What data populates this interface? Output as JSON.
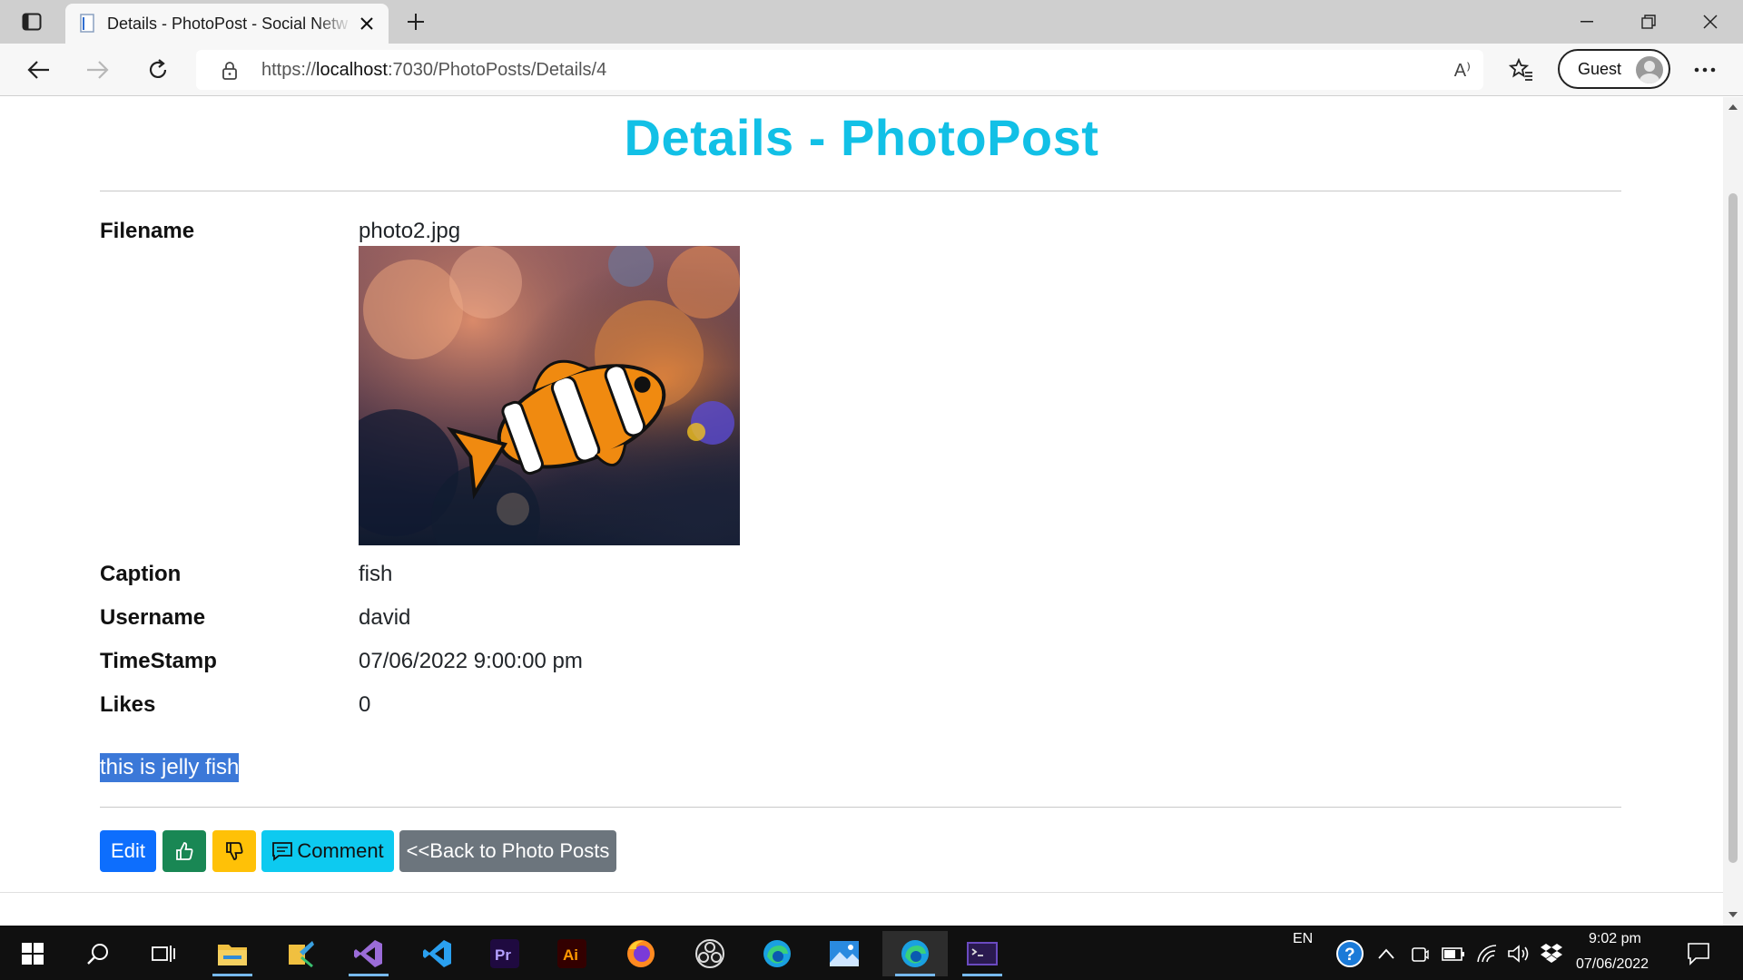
{
  "browser": {
    "tab_title": "Details - PhotoPost - Social Netw",
    "url_scheme": "https://",
    "url_host": "localhost",
    "url_path": ":7030/PhotoPosts/Details/4",
    "profile_label": "Guest",
    "read_aloud_label": "A⁾"
  },
  "page": {
    "title": "Details - PhotoPost",
    "fields": {
      "filename_label": "Filename",
      "filename_value": "photo2.jpg",
      "caption_label": "Caption",
      "caption_value": "fish",
      "username_label": "Username",
      "username_value": "david",
      "timestamp_label": "TimeStamp",
      "timestamp_value": "07/06/2022 9:00:00 pm",
      "likes_label": "Likes",
      "likes_value": "0"
    },
    "comment_text": "this is jelly fish",
    "buttons": {
      "edit": "Edit",
      "comment": "Comment",
      "back": "<<Back to Photo Posts"
    }
  },
  "taskbar": {
    "language": "EN",
    "time": "9:02 pm",
    "date": "07/06/2022"
  },
  "colors": {
    "title": "#12c0e6",
    "edit": "#0d6efd",
    "like": "#198754",
    "dislike": "#ffc107",
    "comment": "#0dcaf0",
    "back": "#6c757d",
    "selection": "#3b78d8"
  }
}
